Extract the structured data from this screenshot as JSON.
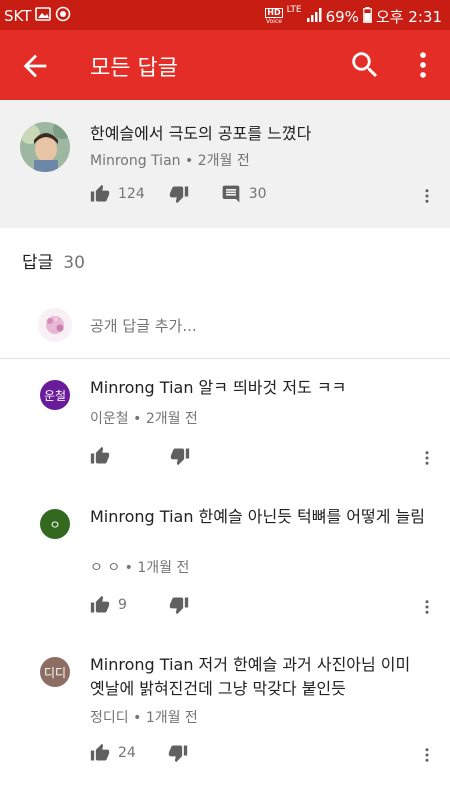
{
  "status_bar": {
    "carrier": "SKT",
    "hd_label": "HD",
    "voice_label": "Voice",
    "lte_label": "LTE",
    "battery": "69%",
    "time": "오후 2:31"
  },
  "app_bar": {
    "title": "모든 답글"
  },
  "original_comment": {
    "text": "한예슬에서 극도의 공포를 느꼈다",
    "author": "Minrong Tian",
    "age": "2개월 전",
    "likes": "124",
    "reply_count": "30"
  },
  "replies_header": {
    "label": "답글",
    "count": "30"
  },
  "add_reply": {
    "placeholder": "공개 답글 추가..."
  },
  "replies": [
    {
      "avatar_text": "운철",
      "avatar_color": "#6a1b9a",
      "text": "Minrong Tian 알ㅋ 띄바것 저도 ㅋㅋ",
      "author": "이운철",
      "age": "2개월 전",
      "likes": ""
    },
    {
      "avatar_text": "ㅇ",
      "avatar_color": "#33691e",
      "text": "Minrong Tian 한예슬 아닌듯 턱뼈를 어떻게 늘림",
      "author": "ㅇ ㅇ",
      "age": "1개월 전",
      "likes": "9"
    },
    {
      "avatar_text": "디디",
      "avatar_color": "#8d6e63",
      "text": "Minrong Tian 저거 한예슬 과거 사진아님 이미 옛날에 밝혀진건데 그냥 막갖다 붙인듯",
      "author": "정디디",
      "age": "1개월 전",
      "likes": "24"
    }
  ],
  "icons": {
    "back": "arrow-back-icon",
    "search": "search-icon",
    "more": "more-vert-icon",
    "like": "thumb-up-icon",
    "dislike": "thumb-down-icon",
    "comment": "comment-icon"
  },
  "colors": {
    "status_bar": "#c81d12",
    "app_bar": "#e52d27",
    "original_bg": "#f1f1f1",
    "meta_text": "#757575",
    "icon": "#606060"
  }
}
